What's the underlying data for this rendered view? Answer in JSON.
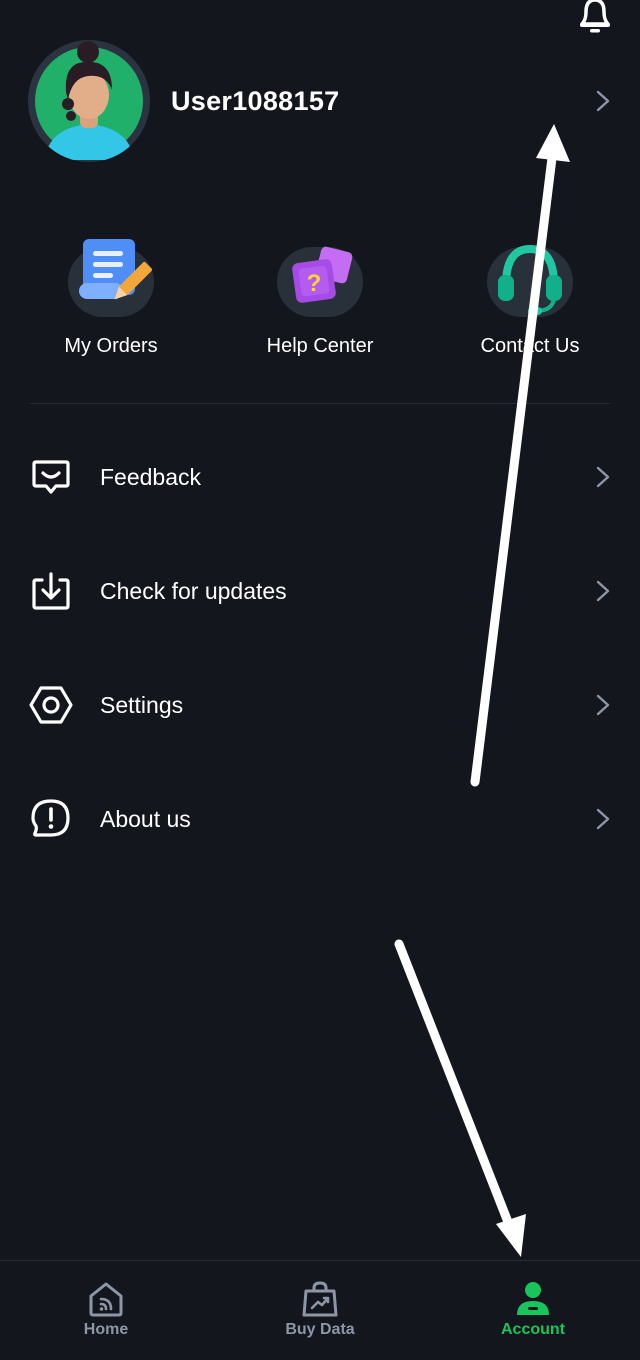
{
  "profile": {
    "username": "User1088157"
  },
  "quick_actions": [
    {
      "label": "My Orders",
      "icon": "orders-scroll-icon"
    },
    {
      "label": "Help Center",
      "icon": "help-question-icon"
    },
    {
      "label": "Contact Us",
      "icon": "headset-icon"
    }
  ],
  "menu": [
    {
      "label": "Feedback",
      "icon": "feedback-icon"
    },
    {
      "label": "Check for updates",
      "icon": "download-update-icon"
    },
    {
      "label": "Settings",
      "icon": "hexagon-settings-icon"
    },
    {
      "label": "About us",
      "icon": "info-bubble-icon"
    }
  ],
  "nav": {
    "tabs": [
      {
        "label": "Home",
        "icon": "home-icon"
      },
      {
        "label": "Buy Data",
        "icon": "shopping-bag-icon"
      },
      {
        "label": "Account",
        "icon": "account-icon"
      }
    ],
    "active": "Account"
  },
  "colors": {
    "background": "#13171d",
    "accent_green": "#19c55a",
    "inactive_tab": "#8c96a6",
    "divider": "#262c35"
  }
}
